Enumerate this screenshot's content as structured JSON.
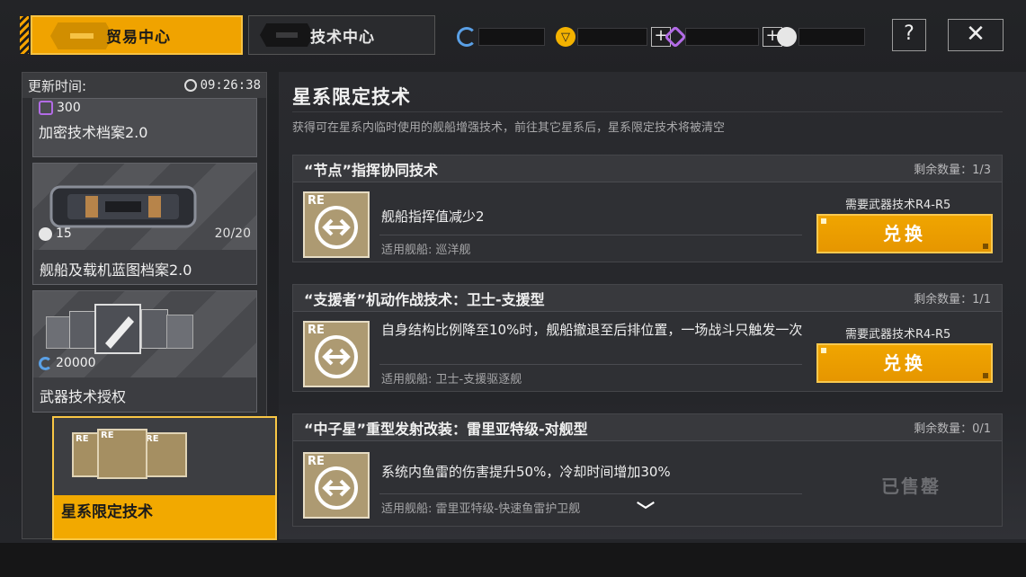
{
  "tabs": {
    "trade": "贸易中心",
    "tech": "技术中心"
  },
  "currencies": [
    {
      "icon": "credit-icon",
      "color": "#5aa0e6",
      "value": ""
    },
    {
      "icon": "gold-icon",
      "color": "#f3b200",
      "value": ""
    },
    {
      "icon": "purple-token-icon",
      "color": "#b26be6",
      "value": ""
    },
    {
      "icon": "tech-point-icon",
      "color": "#e6e6e6",
      "value": ""
    }
  ],
  "topbar": {
    "help": "?",
    "close": "✕"
  },
  "sidebar": {
    "refresh_label": "更新时间:",
    "refresh_time": "09:26:38",
    "items": [
      {
        "cost": "300",
        "cost_icon": "purple-token-icon",
        "name": "加密技术档案2.0"
      },
      {
        "cost": "15",
        "cost_icon": "tech-point-icon",
        "stock": "20/20",
        "name": "舰船及载机蓝图档案2.0"
      },
      {
        "cost": "20000",
        "cost_icon": "credit-icon",
        "name": "武器技术授权"
      },
      {
        "name": "星系限定技术"
      }
    ]
  },
  "main": {
    "title": "星系限定技术",
    "subtitle": "获得可在星系内临时使用的舰船增强技术，前往其它星系后，星系限定技术将被清空",
    "items": [
      {
        "name": "“节点”指挥协同技术",
        "remaining": "剩余数量：1/3",
        "desc": "舰船指挥值减少2",
        "ship": "适用舰船: 巡洋舰",
        "requirement": "需要武器技术R4-R5",
        "button": "兑换"
      },
      {
        "name": "“支援者”机动作战技术：卫士-支援型",
        "remaining": "剩余数量：1/1",
        "desc": "自身结构比例降至10%时，舰船撤退至后排位置，一场战斗只触发一次",
        "ship": "适用舰船: 卫士-支援驱逐舰",
        "requirement": "需要武器技术R4-R5",
        "button": "兑换"
      },
      {
        "name": "“中子星”重型发射改装：雷里亚特级-对舰型",
        "remaining": "剩余数量：0/1",
        "desc": "系统内鱼雷的伤害提升50%，冷却时间增加30%",
        "ship": "适用舰船: 雷里亚特级-快速鱼雷护卫舰",
        "status": "已售罄"
      }
    ],
    "tech_icon_label": "RE"
  },
  "colors": {
    "accent": "#f0a300",
    "panel": "#2f3034"
  }
}
